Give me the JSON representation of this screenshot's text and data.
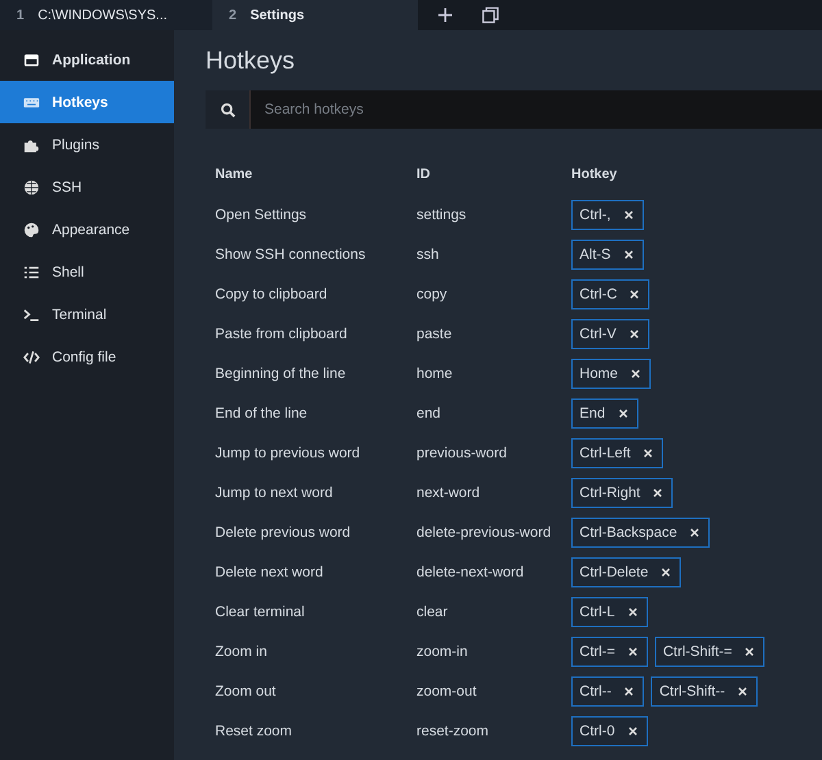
{
  "tabs": [
    {
      "number": "1",
      "label": "C:\\WINDOWS\\SYS...",
      "selected": false
    },
    {
      "number": "2",
      "label": "Settings",
      "selected": true
    }
  ],
  "sidebar": {
    "items": [
      {
        "label": "Application",
        "selected": false
      },
      {
        "label": "Hotkeys",
        "selected": true
      },
      {
        "label": "Plugins",
        "selected": false
      },
      {
        "label": "SSH",
        "selected": false
      },
      {
        "label": "Appearance",
        "selected": false
      },
      {
        "label": "Shell",
        "selected": false
      },
      {
        "label": "Terminal",
        "selected": false
      },
      {
        "label": "Config file",
        "selected": false
      }
    ]
  },
  "page": {
    "title": "Hotkeys",
    "search": {
      "placeholder": "Search hotkeys"
    }
  },
  "table": {
    "columns": [
      "Name",
      "ID",
      "Hotkey"
    ],
    "rows": [
      {
        "name": "Open Settings",
        "id": "settings",
        "hotkeys": [
          "Ctrl-,"
        ]
      },
      {
        "name": "Show SSH connections",
        "id": "ssh",
        "hotkeys": [
          "Alt-S"
        ]
      },
      {
        "name": "Copy to clipboard",
        "id": "copy",
        "hotkeys": [
          "Ctrl-C"
        ]
      },
      {
        "name": "Paste from clipboard",
        "id": "paste",
        "hotkeys": [
          "Ctrl-V"
        ]
      },
      {
        "name": "Beginning of the line",
        "id": "home",
        "hotkeys": [
          "Home"
        ]
      },
      {
        "name": "End of the line",
        "id": "end",
        "hotkeys": [
          "End"
        ]
      },
      {
        "name": "Jump to previous word",
        "id": "previous-word",
        "hotkeys": [
          "Ctrl-Left"
        ]
      },
      {
        "name": "Jump to next word",
        "id": "next-word",
        "hotkeys": [
          "Ctrl-Right"
        ]
      },
      {
        "name": "Delete previous word",
        "id": "delete-previous-word",
        "hotkeys": [
          "Ctrl-Backspace"
        ]
      },
      {
        "name": "Delete next word",
        "id": "delete-next-word",
        "hotkeys": [
          "Ctrl-Delete"
        ]
      },
      {
        "name": "Clear terminal",
        "id": "clear",
        "hotkeys": [
          "Ctrl-L"
        ]
      },
      {
        "name": "Zoom in",
        "id": "zoom-in",
        "hotkeys": [
          "Ctrl-=",
          "Ctrl-Shift-="
        ]
      },
      {
        "name": "Zoom out",
        "id": "zoom-out",
        "hotkeys": [
          "Ctrl--",
          "Ctrl-Shift--"
        ]
      },
      {
        "name": "Reset zoom",
        "id": "reset-zoom",
        "hotkeys": [
          "Ctrl-0"
        ]
      }
    ]
  }
}
